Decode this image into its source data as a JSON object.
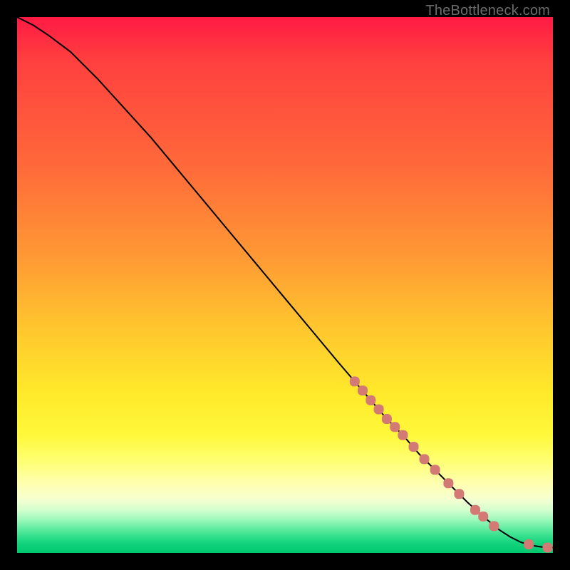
{
  "watermark": "TheBottleneck.com",
  "colors": {
    "dot": "#d47a74",
    "curve": "#000000"
  },
  "chart_data": {
    "type": "line",
    "title": "",
    "xlabel": "",
    "ylabel": "",
    "xlim": [
      0,
      100
    ],
    "ylim": [
      0,
      100
    ],
    "grid": false,
    "legend": false,
    "curve": {
      "comment": "Monotone decreasing curve from top-left to bottom-right; values are (x, y) in 0–100 plot-area coords, y=100 at top, y=0 at bottom.",
      "points": [
        [
          0,
          100
        ],
        [
          3,
          98.5
        ],
        [
          6,
          96.5
        ],
        [
          10,
          93.5
        ],
        [
          15,
          88.5
        ],
        [
          20,
          83
        ],
        [
          25,
          77.5
        ],
        [
          30,
          71.5
        ],
        [
          35,
          65.5
        ],
        [
          40,
          59.5
        ],
        [
          45,
          53.5
        ],
        [
          50,
          47.5
        ],
        [
          55,
          41.5
        ],
        [
          60,
          35.5
        ],
        [
          63,
          32
        ],
        [
          66,
          28.5
        ],
        [
          69,
          25
        ],
        [
          72,
          22
        ],
        [
          75,
          18.5
        ],
        [
          78,
          15.5
        ],
        [
          81,
          12.5
        ],
        [
          84,
          9.5
        ],
        [
          87,
          6.8
        ],
        [
          90,
          4.3
        ],
        [
          92,
          3.0
        ],
        [
          94,
          2.0
        ],
        [
          96,
          1.4
        ],
        [
          98,
          1.1
        ],
        [
          100,
          1.0
        ]
      ]
    },
    "series": [
      {
        "name": "markers",
        "comment": "Highlighted rounded-rect markers along lower portion of the curve plus two near bottom-right; (x,y) in 0–100 plot coords.",
        "points": [
          [
            63.0,
            32.0
          ],
          [
            64.5,
            30.3
          ],
          [
            66.0,
            28.5
          ],
          [
            67.5,
            26.8
          ],
          [
            69.0,
            25.0
          ],
          [
            70.5,
            23.5
          ],
          [
            72.0,
            22.0
          ],
          [
            74.0,
            19.8
          ],
          [
            76.0,
            17.5
          ],
          [
            78.0,
            15.5
          ],
          [
            80.5,
            13.0
          ],
          [
            82.5,
            11.0
          ],
          [
            85.5,
            8.0
          ],
          [
            87.0,
            6.8
          ],
          [
            89.0,
            5.0
          ],
          [
            95.5,
            1.6
          ],
          [
            99.0,
            1.0
          ]
        ]
      }
    ]
  }
}
